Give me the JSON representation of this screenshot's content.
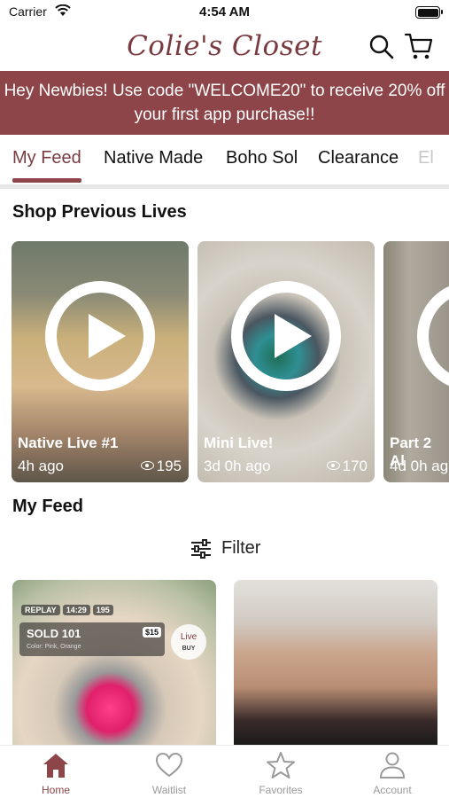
{
  "status_bar": {
    "carrier": "Carrier",
    "time": "4:54 AM"
  },
  "header": {
    "logo_text": "Colie's Closet"
  },
  "promo": {
    "text": "Hey Newbies! Use code \"WELCOME20\" to receive 20% off your first app purchase!!"
  },
  "tabs": [
    {
      "label": "My Feed",
      "active": true
    },
    {
      "label": "Native Made",
      "active": false
    },
    {
      "label": "Boho Sol",
      "active": false
    },
    {
      "label": "Clearance",
      "active": false
    },
    {
      "label": "El",
      "active": false
    }
  ],
  "previous_lives": {
    "title": "Shop Previous Lives",
    "items": [
      {
        "title": "Native Live #1",
        "ago": "4h ago",
        "views": "195"
      },
      {
        "title": "Mini Live!",
        "ago": "3d 0h ago",
        "views": "170"
      },
      {
        "title": "Part 2 Al",
        "ago": "4d 0h ag",
        "views": ""
      }
    ]
  },
  "feed": {
    "title": "My Feed",
    "filter_label": "Filter",
    "products": [
      {
        "overlay_tags": [
          "REPLAY",
          "14:29",
          "195"
        ],
        "sold_title": "SOLD 101",
        "price": "$15",
        "sold_sub": "Color: Pink, Orange",
        "live_label": "Live",
        "buy_label": "BUY"
      },
      {}
    ]
  },
  "bottom_nav": [
    {
      "label": "Home",
      "icon": "home-icon",
      "active": true
    },
    {
      "label": "Waitlist",
      "icon": "heart-icon",
      "active": false
    },
    {
      "label": "Favorites",
      "icon": "star-icon",
      "active": false
    },
    {
      "label": "Account",
      "icon": "person-icon",
      "active": false
    }
  ],
  "colors": {
    "brand": "#8e4549",
    "logo": "#7a3b40",
    "inactive": "#9a9a9a"
  }
}
